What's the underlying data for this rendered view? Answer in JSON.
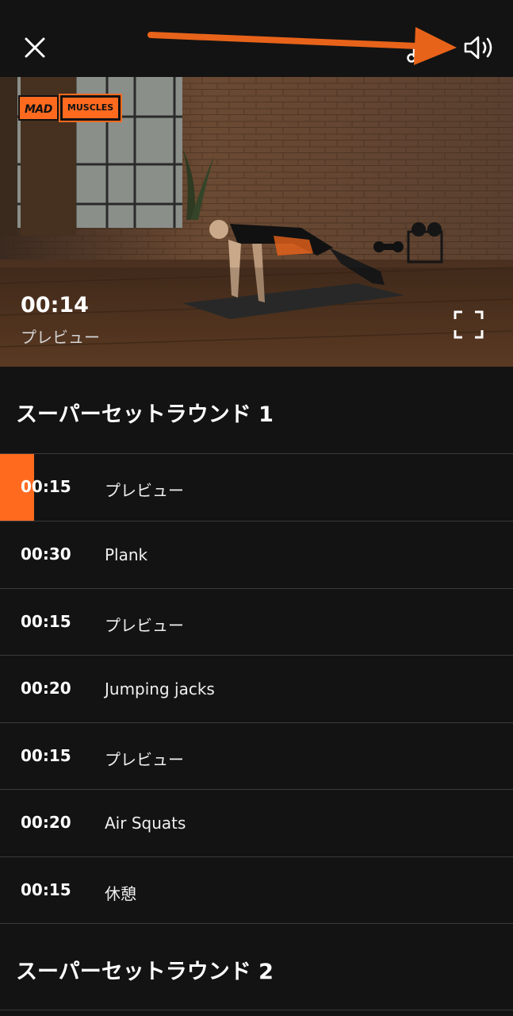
{
  "player": {
    "timer": "00:14",
    "current_label": "プレビュー",
    "logo_left": "MAD",
    "logo_right": "MUSCLES",
    "accent_color": "#ff6a1f"
  },
  "icons": {
    "close": "close-icon",
    "music": "music-note-icon",
    "sound": "speaker-icon",
    "fullscreen": "fullscreen-icon",
    "annotation": "arrow-annotation"
  },
  "sections": [
    {
      "title": "スーパーセットラウンド 1",
      "items": [
        {
          "time": "00:15",
          "name": "プレビュー",
          "progress": 0.0667
        },
        {
          "time": "00:30",
          "name": "Plank"
        },
        {
          "time": "00:15",
          "name": "プレビュー"
        },
        {
          "time": "00:20",
          "name": "Jumping jacks"
        },
        {
          "time": "00:15",
          "name": "プレビュー"
        },
        {
          "time": "00:20",
          "name": "Air Squats"
        },
        {
          "time": "00:15",
          "name": "休憩"
        }
      ]
    },
    {
      "title": "スーパーセットラウンド 2",
      "items": []
    }
  ]
}
